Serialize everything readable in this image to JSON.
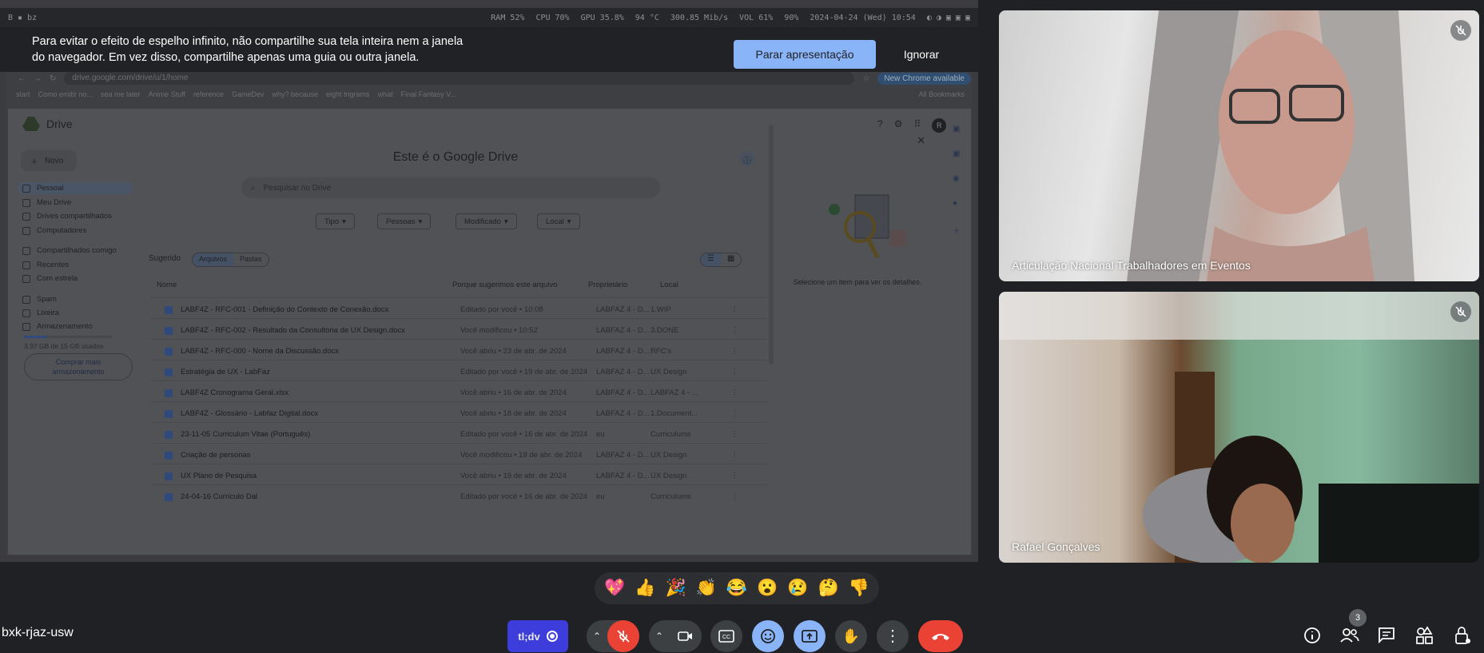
{
  "system_bar": {
    "left": "B  ▪  bz",
    "ram": "RAM 52%",
    "cpu": "CPU 70%",
    "gpu": "GPU 35.8%",
    "temp": "94 °C",
    "net": "300.85 Mib/s",
    "vol": "VOL 61%",
    "bat": "90%",
    "datetime": "2024-04-24 (Wed) 10:54"
  },
  "share_warning": {
    "line1": "Para evitar o efeito de espelho infinito, não compartilhe sua tela inteira nem a janela",
    "line2": "do navegador. Em vez disso, compartilhe apenas uma guia ou outra janela.",
    "stop_label": "Parar apresentação",
    "ignore_label": "Ignorar"
  },
  "browser": {
    "url": "drive.google.com/drive/u/1/home",
    "update_label": "New Chrome available",
    "bookmarks": [
      "start",
      "Como emitir no...",
      "sea me later",
      "Anime Stuff",
      "reference",
      "GameDev",
      "why? because",
      "eight trigrams",
      "what",
      "Final Fantasy V...",
      "All Bookmarks"
    ]
  },
  "drive": {
    "app_name": "Drive",
    "new_label": "Novo",
    "heading": "Este é o Google Drive",
    "search_placeholder": "Pesquisar no Drive",
    "filters": [
      "Tipo",
      "Pessoas",
      "Modificado",
      "Local"
    ],
    "suggested_label": "Sugerido",
    "toggle_files": "Arquivos",
    "toggle_folders": "Pastas",
    "columns": {
      "name": "Nome",
      "reason": "Porque sugerimos este arquivo",
      "owner": "Proprietário",
      "location": "Local"
    },
    "sidebar": [
      "Pessoal",
      "Meu Drive",
      "Drives compartilhados",
      "Computadores",
      "Compartilhados comigo",
      "Recentes",
      "Com estrela",
      "Spam",
      "Lixeira",
      "Armazenamento"
    ],
    "storage": "3,97 GB de 15 GB usados",
    "buy_storage": "Comprar mais armazenamento",
    "details_hint": "Selecione um item para ver os detalhes.",
    "files": [
      {
        "name": "LABF4Z - RFC-001 - Definição do Contexto de Conexão.docx",
        "reason": "Editado por você • 10:08",
        "owner": "LABFAZ 4 - D...",
        "location": "1.WIP"
      },
      {
        "name": "LABF4Z - RFC-002 - Resultado da Consultoria de UX Design.docx",
        "reason": "Você modificou • 10:52",
        "owner": "LABFAZ 4 - D...",
        "location": "3.DONE"
      },
      {
        "name": "LABF4Z - RFC-000 - Nome da Discussão.docx",
        "reason": "Você abriu • 23 de abr. de 2024",
        "owner": "LABFAZ 4 - D...",
        "location": "RFC's"
      },
      {
        "name": "Estratégia de UX - LabFaz",
        "reason": "Editado por você • 19 de abr. de 2024",
        "owner": "LABFAZ 4 - D...",
        "location": "UX Design"
      },
      {
        "name": "LABF4Z Cronograma Geral.xlsx",
        "reason": "Você abriu • 16 de abr. de 2024",
        "owner": "LABFAZ 4 - D...",
        "location": "LABFAZ 4 - ..."
      },
      {
        "name": "LABF4Z - Glossário - Labfaz Digital.docx",
        "reason": "Você abriu • 18 de abr. de 2024",
        "owner": "LABFAZ 4 - D...",
        "location": "1.Document..."
      },
      {
        "name": "23-11-05 Curriculum Vitae (Português)",
        "reason": "Editado por você • 16 de abr. de 2024",
        "owner": "eu",
        "location": "Curriculums"
      },
      {
        "name": "Criação de personas",
        "reason": "Você modificou • 19 de abr. de 2024",
        "owner": "LABFAZ 4 - D...",
        "location": "UX Design"
      },
      {
        "name": "UX Plano de Pesquisa",
        "reason": "Você abriu • 19 de abr. de 2024",
        "owner": "LABFAZ 4 - D...",
        "location": "UX Design"
      },
      {
        "name": "24-04-16 Currículo Dal",
        "reason": "Editado por você • 16 de abr. de 2024",
        "owner": "eu",
        "location": "Curriculums"
      }
    ]
  },
  "participants": [
    {
      "name": "Articulação Nacional Trabalhadores em Eventos"
    },
    {
      "name": "Rafael Gonçalves"
    }
  ],
  "reactions": [
    "💖",
    "👍",
    "🎉",
    "👏",
    "😂",
    "😮",
    "😢",
    "🤔",
    "👎"
  ],
  "meeting_code": "bxk-rjaz-usw",
  "tldv_label": "tl;dv",
  "people_count": "3",
  "colors": {
    "accent": "#8ab4f8",
    "end_call": "#ea4335",
    "mic_off": "#ea4335",
    "tldv": "#3d3ddb"
  }
}
